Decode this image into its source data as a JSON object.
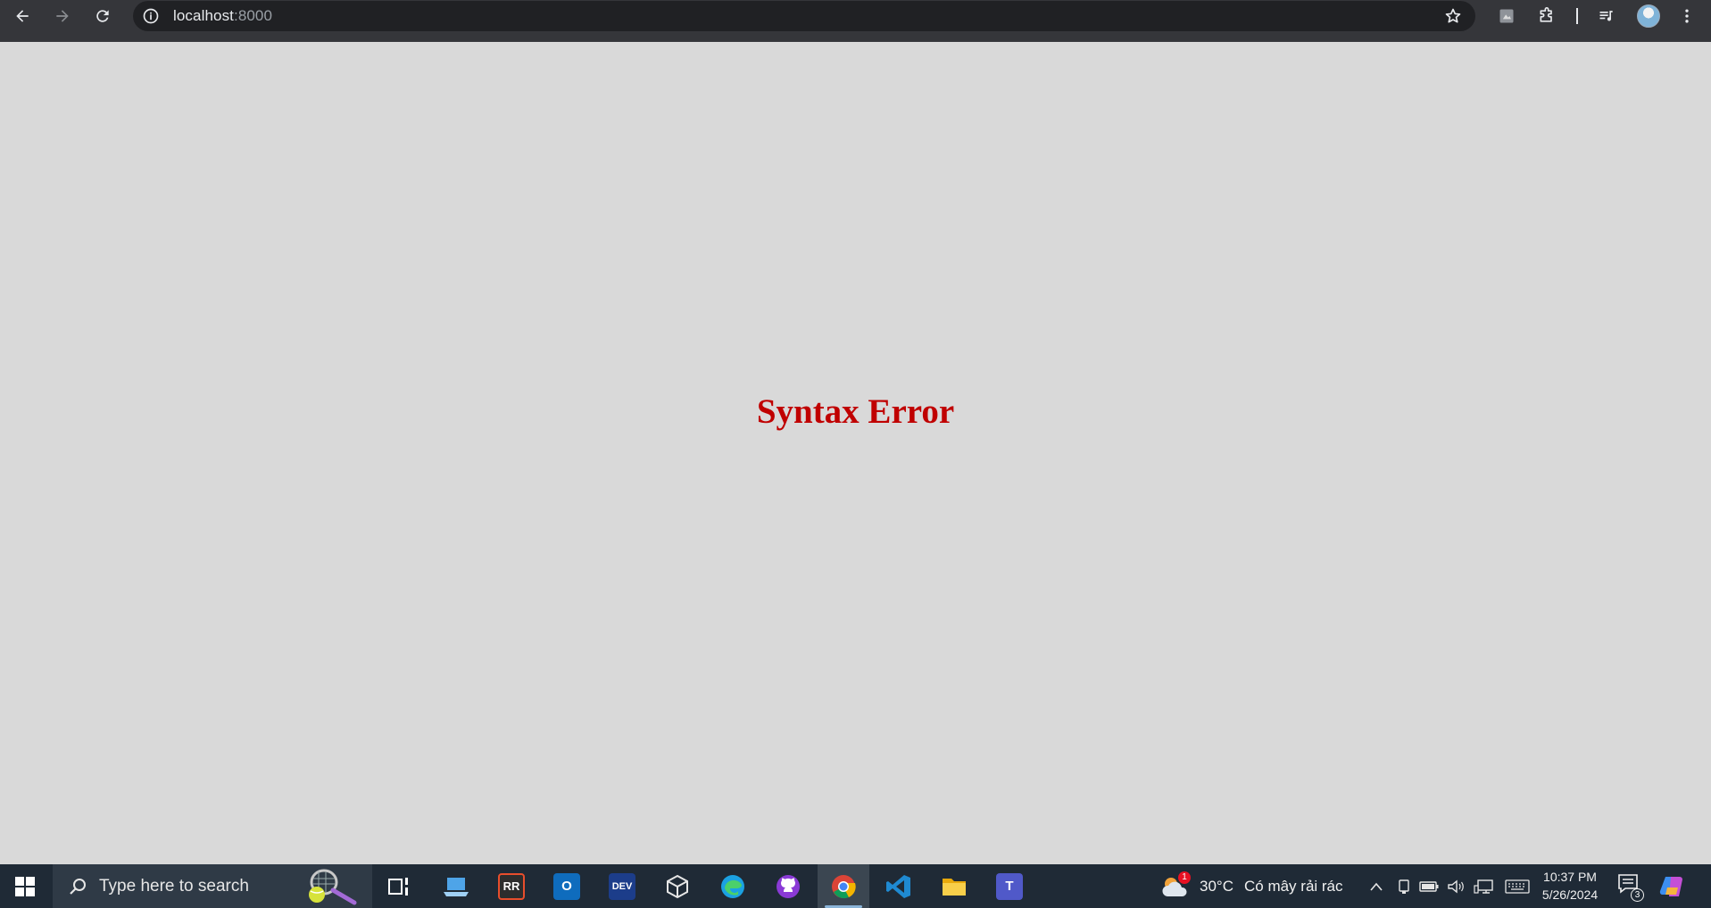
{
  "browser": {
    "url_host": "localhost",
    "url_port": ":8000"
  },
  "page": {
    "message": "Syntax Error",
    "message_color": "#c00000",
    "background_color": "#d9d9d9"
  },
  "taskbar": {
    "search_placeholder": "Type here to search",
    "weather_badge": "1",
    "weather_temp": "30°C",
    "weather_desc": "Có mây rải rác",
    "clock_time": "10:37 PM",
    "clock_date": "5/26/2024",
    "notification_count": "3",
    "apps": [
      {
        "name": "task-view",
        "icon": "task-view-icon"
      },
      {
        "name": "laptop-app",
        "icon": "laptop-icon"
      },
      {
        "name": "rr-review",
        "icon": "rr-review-icon",
        "label": "RR"
      },
      {
        "name": "outlook",
        "icon": "outlook-icon",
        "label": "O"
      },
      {
        "name": "devtoys",
        "icon": "dev-icon",
        "label": "DEV"
      },
      {
        "name": "virtualbox",
        "icon": "cube-icon"
      },
      {
        "name": "edge",
        "icon": "edge-icon"
      },
      {
        "name": "github-desktop",
        "icon": "github-icon"
      },
      {
        "name": "chrome",
        "icon": "chrome-icon"
      },
      {
        "name": "vscode",
        "icon": "vscode-icon"
      },
      {
        "name": "file-explorer",
        "icon": "folder-icon"
      },
      {
        "name": "teams",
        "icon": "teams-icon",
        "label": "T"
      }
    ]
  }
}
